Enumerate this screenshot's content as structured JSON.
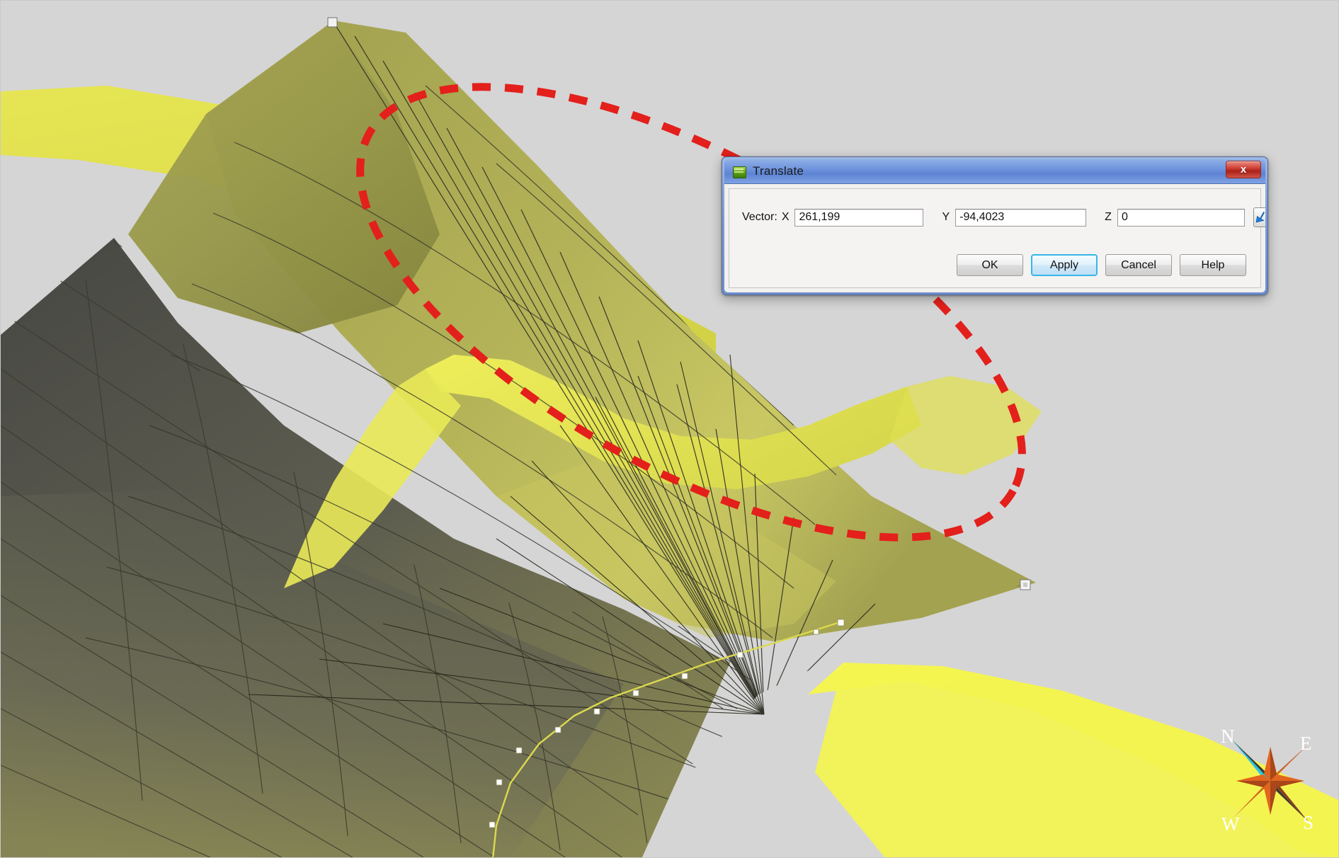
{
  "scene": {
    "name": "3d-geological-model-viewport",
    "background_color": "#d5d5d6",
    "surface_colors": {
      "bright_yellow_band": "#e8e84e",
      "olive_surface": "#9d9c4e",
      "dark_mesh": "#54544c",
      "wire_color": "#2b2b20",
      "vertex_marker": "#ffffff",
      "polyline": "#e6e05a"
    }
  },
  "annotation": {
    "name": "red-dashed-ellipse",
    "color": "#e3201b",
    "stroke_width": 11,
    "dash": "26 20",
    "shape": "ellipse"
  },
  "dialog": {
    "title": "Translate",
    "icon": "green-app-icon",
    "close_label": "x",
    "fields": {
      "vector_label": "Vector:",
      "x_label": "X",
      "x_value": "261,199",
      "y_label": "Y",
      "y_value": "-94,4023",
      "z_label": "Z",
      "z_value": "0",
      "pick_icon": "arrow-cursor-icon"
    },
    "buttons": [
      {
        "label": "OK",
        "focused": false
      },
      {
        "label": "Apply",
        "focused": true
      },
      {
        "label": "Cancel",
        "focused": false
      },
      {
        "label": "Help",
        "focused": false
      }
    ]
  },
  "compass": {
    "north": "N",
    "east": "E",
    "south": "S",
    "west": "W",
    "needle_color": "#2ec4e0",
    "rose_color": "#e2651f",
    "rose_dark": "#3a3a36"
  }
}
